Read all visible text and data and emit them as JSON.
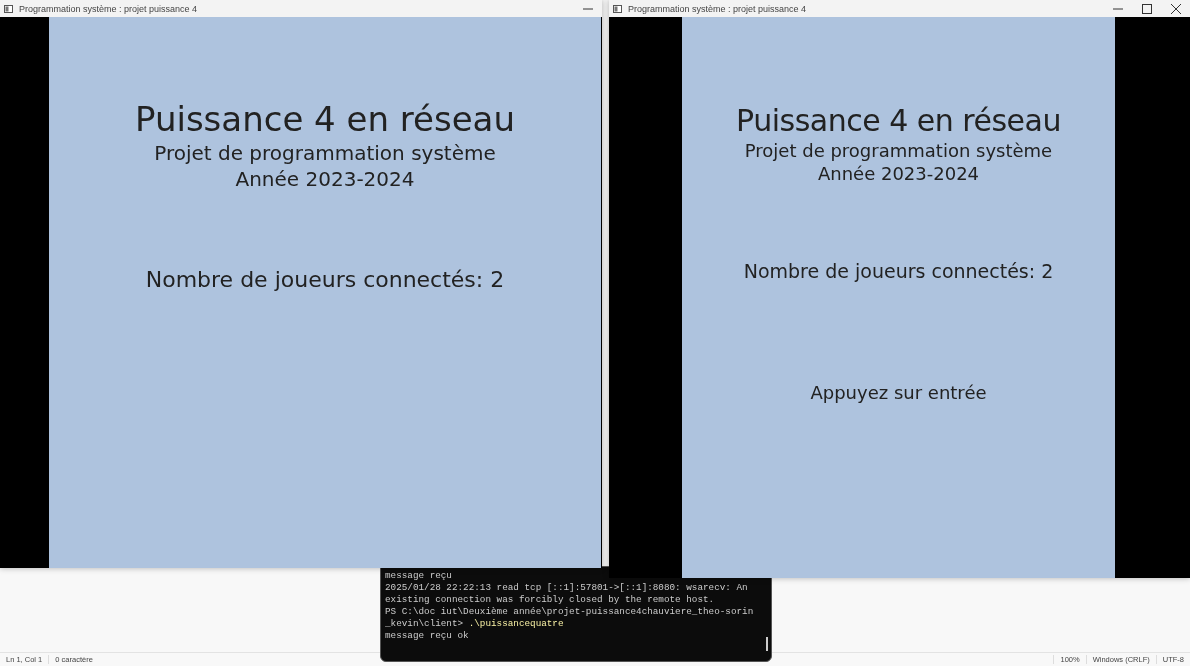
{
  "windows": [
    {
      "title": "Programmation système : projet puissance 4",
      "buttons": [
        {
          "kind": "minimize"
        }
      ],
      "heading": "Puissance 4 en réseau",
      "subtitle": "Projet de programmation système",
      "year": "Année 2023-2024",
      "players": "Nombre de joueurs connectés: 2"
    },
    {
      "title": "Programmation système : projet puissance 4",
      "buttons": [
        {
          "kind": "minimize"
        },
        {
          "kind": "maximize"
        },
        {
          "kind": "close"
        }
      ],
      "heading": "Puissance 4 en réseau",
      "subtitle": "Projet de programmation système",
      "year": "Année 2023-2024",
      "players": "Nombre de joueurs connectés: 2",
      "prompt": "Appuyez sur entrée"
    }
  ],
  "terminal": {
    "lines": [
      {
        "text": "message reçu"
      },
      {
        "text": "2025/01/28 22:22:13 read tcp [::1]:57801->[::1]:8080: wsarecv: An"
      },
      {
        "text": "existing connection was forcibly closed by the remote host."
      },
      {
        "text": "PS C:\\doc iut\\Deuxième année\\projet-puissance4chauviere_theo-sorin"
      },
      {
        "text": "_kevin\\client> ",
        "command": ".\\puissancequatre"
      },
      {
        "text": "message reçu ok"
      }
    ]
  },
  "status_bar": [
    "Ln 1, Col 1",
    "0 caractère",
    "100%",
    "Windows (CRLF)",
    "UTF-8"
  ]
}
